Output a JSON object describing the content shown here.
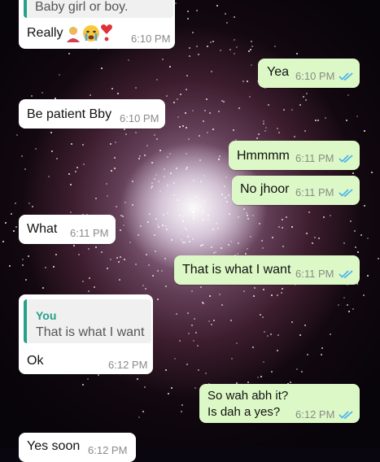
{
  "messages": [
    {
      "quote_text": "Baby girl or boy.",
      "text": "Really",
      "time": "6:10 PM",
      "direction": "in"
    },
    {
      "text": "Yea",
      "time": "6:10 PM",
      "direction": "out",
      "status": "read"
    },
    {
      "text": "Be patient Bby",
      "time": "6:10 PM",
      "direction": "in"
    },
    {
      "text": "Hmmmm",
      "time": "6:11 PM",
      "direction": "out",
      "status": "read"
    },
    {
      "text": "No jhoor",
      "time": "6:11 PM",
      "direction": "out",
      "status": "read"
    },
    {
      "text": "What",
      "time": "6:11 PM",
      "direction": "in"
    },
    {
      "text": "That is what I want",
      "time": "6:11 PM",
      "direction": "out",
      "status": "read"
    },
    {
      "quote_author": "You",
      "quote_text": "That is what I want",
      "text": "Ok",
      "time": "6:12 PM",
      "direction": "in"
    },
    {
      "text_line1": "So wah abh it?",
      "text_line2": "Is dah a yes?",
      "time": "6:12 PM",
      "direction": "out",
      "status": "read"
    },
    {
      "text": "Yes soon",
      "time": "6:12 PM",
      "direction": "in"
    }
  ],
  "emojis": [
    "person-icon",
    "crying-face-icon",
    "heart-exclamation-icon"
  ],
  "colors": {
    "incoming": "#ffffff",
    "outgoing": "#dcf8c6",
    "read_ticks": "#4fb6ec",
    "quote_accent": "#25a089"
  }
}
